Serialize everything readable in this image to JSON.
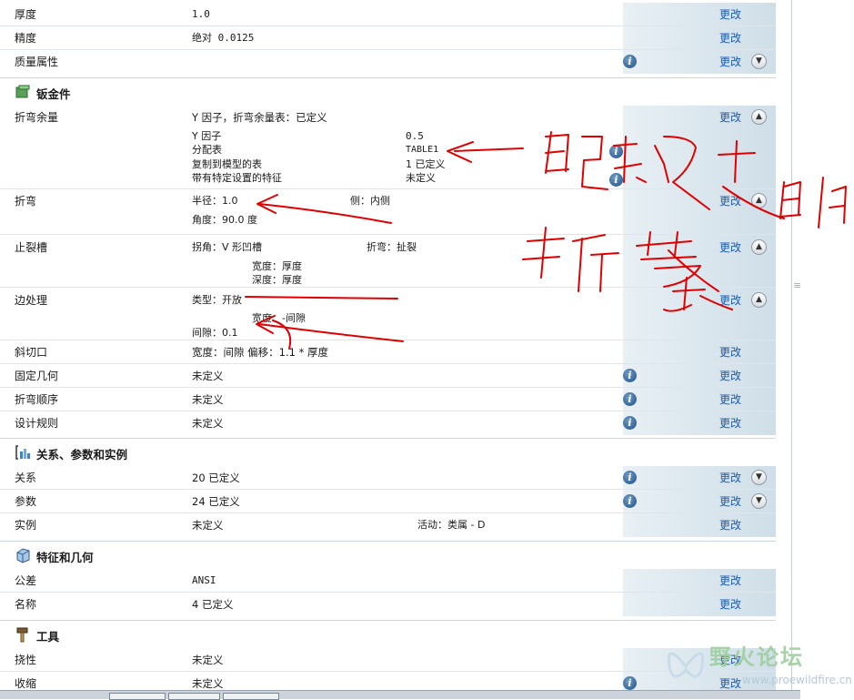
{
  "action_label": "更改",
  "top_rows": [
    {
      "label": "厚度",
      "value": "1.0"
    },
    {
      "label": "精度",
      "value": "绝对 0.0125"
    },
    {
      "label": "质量属性",
      "value": ""
    }
  ],
  "sheetmetal": {
    "title": "钣金件",
    "bend_allowance": {
      "label": "折弯余量",
      "summary": "Y 因子，折弯余量表：已定义",
      "details": [
        {
          "k": "Y 因子",
          "v": "0.5"
        },
        {
          "k": "分配表",
          "v": "TABLE1"
        },
        {
          "k": "复制到模型的表",
          "v": "1 已定义"
        },
        {
          "k": "带有特定设置的特征",
          "v": "未定义"
        }
      ]
    },
    "bend": {
      "label": "折弯",
      "radius": "半径：1.0",
      "side": "侧：内侧",
      "angle": "角度：90.0 度"
    },
    "relief": {
      "label": "止裂槽",
      "corner": "拐角：V 形凹槽",
      "bend": "折弯：扯裂",
      "width": "宽度：厚度",
      "depth": "深度：厚度"
    },
    "edge": {
      "label": "边处理",
      "type": "类型：开放",
      "width": "宽度：-间隙",
      "gap": "间隙：0.1"
    },
    "miter": {
      "label": "斜切口",
      "value": "宽度：间隙 偏移：1.1 * 厚度"
    },
    "fixed_geom": {
      "label": "固定几何",
      "value": "未定义"
    },
    "bend_order": {
      "label": "折弯顺序",
      "value": "未定义"
    },
    "design_rules": {
      "label": "设计规则",
      "value": "未定义"
    }
  },
  "relations": {
    "title": "关系、参数和实例",
    "rows": [
      {
        "label": "关系",
        "value": "20 已定义"
      },
      {
        "label": "参数",
        "value": "24 已定义"
      },
      {
        "label": "实例",
        "value": "未定义",
        "extra": "活动：类属 - D"
      }
    ]
  },
  "features": {
    "title": "特征和几何",
    "rows": [
      {
        "label": "公差",
        "value": "ANSI"
      },
      {
        "label": "名称",
        "value": "4 已定义"
      }
    ]
  },
  "tools": {
    "title": "工具",
    "rows": [
      {
        "label": "挠性",
        "value": "未定义"
      },
      {
        "label": "收缩",
        "value": "未定义"
      }
    ]
  },
  "annotation": {
    "line1": "已修改过的",
    "line2": "折弯表",
    "color": "#e00000"
  },
  "watermark": {
    "text": "野火论坛",
    "url": "www.proewildfire.cn"
  },
  "colors": {
    "link": "#1a5ab0",
    "help_icon": "#1e4f86",
    "panel": "#dbe7ee"
  }
}
